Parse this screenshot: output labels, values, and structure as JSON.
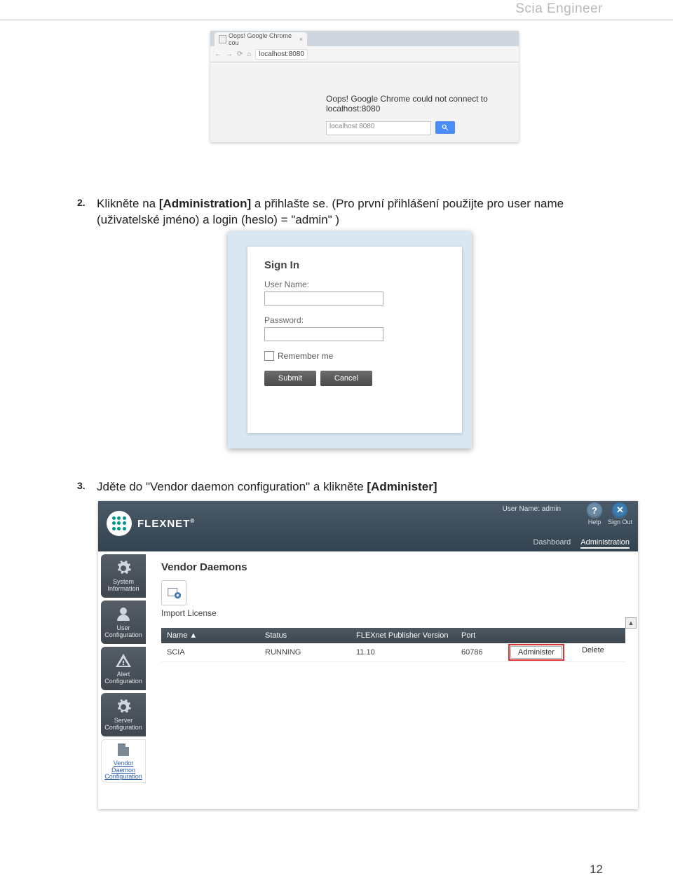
{
  "header": {
    "brand": "Scia Engineer"
  },
  "page_number": "12",
  "chrome": {
    "tab_title": "Oops! Google Chrome cou",
    "address": "localhost:8080",
    "error_msg": "Oops! Google Chrome could not connect to localhost:8080",
    "search_value": "localhost 8080"
  },
  "steps": {
    "s2": {
      "num": "2.",
      "pre": "Klikněte na ",
      "bold": "[Administration]",
      "post": " a přihlašte se. (Pro první přihlášení použijte pro user name (uživatelské jméno) a login (heslo) = \"admin\" )"
    },
    "s3": {
      "num": "3.",
      "pre": "Jděte do \"Vendor daemon configuration\" a klikněte ",
      "bold": "[Administer]"
    }
  },
  "signin": {
    "title": "Sign In",
    "user_label": "User Name:",
    "pass_label": "Password:",
    "remember": "Remember me",
    "submit": "Submit",
    "cancel": "Cancel"
  },
  "flex": {
    "brand": "FLEXNET",
    "user_line": "User Name: admin",
    "help": "Help",
    "signout": "Sign Out",
    "tab_dashboard": "Dashboard",
    "tab_admin": "Administration",
    "sidebar": {
      "sys": "System Information",
      "user": "User Configuration",
      "alert": "Alert Configuration",
      "server": "Server Configuration",
      "vendor": "Vendor Daemon Configuration"
    },
    "main": {
      "title": "Vendor Daemons",
      "import": "Import License",
      "cols": {
        "name": "Name",
        "status": "Status",
        "ver": "FLEXnet Publisher Version",
        "port": "Port"
      },
      "row": {
        "name": "SCIA",
        "status": "RUNNING",
        "ver": "11.10",
        "port": "60786",
        "admin": "Administer",
        "delete": "Delete"
      }
    }
  }
}
